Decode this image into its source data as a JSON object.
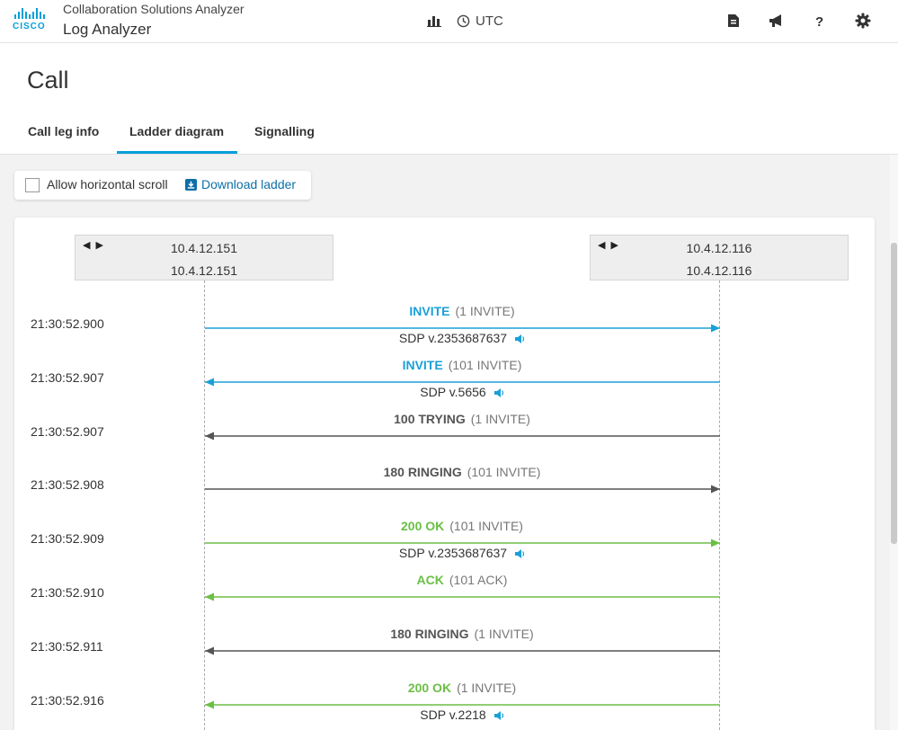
{
  "header": {
    "logo_text": "CISCO",
    "app_name": "Collaboration Solutions Analyzer",
    "app_sub": "Log Analyzer",
    "timezone": "UTC",
    "icons": [
      "bar-chart-icon",
      "clock-icon",
      "document-icon",
      "megaphone-icon",
      "help-icon",
      "gear-icon"
    ]
  },
  "page": {
    "title": "Call"
  },
  "tabs": [
    {
      "label": "Call leg info",
      "active": false
    },
    {
      "label": "Ladder diagram",
      "active": true
    },
    {
      "label": "Signalling",
      "active": false
    }
  ],
  "options": {
    "scroll_label": "Allow horizontal scroll",
    "scroll_checked": false,
    "download_label": "Download ladder"
  },
  "colors": {
    "accent": "#049fd9",
    "invite": "#1aa0d8",
    "ok": "#6bbf45",
    "neutral": "#555555",
    "link": "#0d6fa8"
  },
  "endpoints": [
    {
      "ip": "10.4.12.151",
      "host": "10.4.12.151"
    },
    {
      "ip": "10.4.12.116",
      "host": "10.4.12.116"
    }
  ],
  "messages": [
    {
      "time": "21:30:52.900",
      "name": "INVITE",
      "tx": "(1 INVITE)",
      "direction": "right",
      "color": "#1aa0d8",
      "sdp": "SDP v.2353687637"
    },
    {
      "time": "21:30:52.907",
      "name": "INVITE",
      "tx": "(101 INVITE)",
      "direction": "left",
      "color": "#1aa0d8",
      "sdp": "SDP v.5656"
    },
    {
      "time": "21:30:52.907",
      "name": "100 TRYING",
      "tx": "(1 INVITE)",
      "direction": "left",
      "color": "#555555",
      "sdp": ""
    },
    {
      "time": "21:30:52.908",
      "name": "180 RINGING",
      "tx": "(101 INVITE)",
      "direction": "right",
      "color": "#555555",
      "sdp": ""
    },
    {
      "time": "21:30:52.909",
      "name": "200 OK",
      "tx": "(101 INVITE)",
      "direction": "right",
      "color": "#6bbf45",
      "sdp": "SDP v.2353687637"
    },
    {
      "time": "21:30:52.910",
      "name": "ACK",
      "tx": "(101 ACK)",
      "direction": "left",
      "color": "#6bbf45",
      "sdp": ""
    },
    {
      "time": "21:30:52.911",
      "name": "180 RINGING",
      "tx": "(1 INVITE)",
      "direction": "left",
      "color": "#555555",
      "sdp": ""
    },
    {
      "time": "21:30:52.916",
      "name": "200 OK",
      "tx": "(1 INVITE)",
      "direction": "left",
      "color": "#6bbf45",
      "sdp": "SDP v.2218"
    }
  ]
}
